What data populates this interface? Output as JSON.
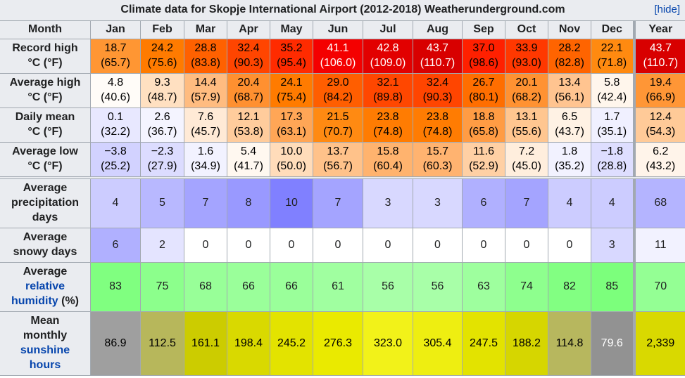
{
  "title": "Climate data for Skopje International Airport (2012-2018) Weatherunderground.com",
  "hide_link": "[hide]",
  "header": {
    "month_label": "Month",
    "months": [
      "Jan",
      "Feb",
      "Mar",
      "Apr",
      "May",
      "Jun",
      "Jul",
      "Aug",
      "Sep",
      "Oct",
      "Nov",
      "Dec"
    ],
    "year_label": "Year"
  },
  "rows": {
    "record_high": {
      "label_line1": "Record high",
      "label_line2": "°C (°F)",
      "values": [
        {
          "c": "18.7",
          "f": "(65.7)",
          "bg": "#ff9633",
          "fg": "#000000"
        },
        {
          "c": "24.2",
          "f": "(75.6)",
          "bg": "#ff7b00",
          "fg": "#000000"
        },
        {
          "c": "28.8",
          "f": "(83.8)",
          "bg": "#ff6100",
          "fg": "#000000"
        },
        {
          "c": "32.4",
          "f": "(90.3)",
          "bg": "#ff4500",
          "fg": "#000000"
        },
        {
          "c": "35.2",
          "f": "(95.4)",
          "bg": "#ff2b00",
          "fg": "#000000"
        },
        {
          "c": "41.1",
          "f": "(106.0)",
          "bg": "#f40000",
          "fg": "#ffffff"
        },
        {
          "c": "42.8",
          "f": "(109.0)",
          "bg": "#e20000",
          "fg": "#ffffff"
        },
        {
          "c": "43.7",
          "f": "(110.7)",
          "bg": "#d80000",
          "fg": "#ffffff"
        },
        {
          "c": "37.0",
          "f": "(98.6)",
          "bg": "#ff2000",
          "fg": "#000000"
        },
        {
          "c": "33.9",
          "f": "(93.0)",
          "bg": "#ff3800",
          "fg": "#000000"
        },
        {
          "c": "28.2",
          "f": "(82.8)",
          "bg": "#ff6400",
          "fg": "#000000"
        },
        {
          "c": "22.1",
          "f": "(71.8)",
          "bg": "#ff8a10",
          "fg": "#000000"
        }
      ],
      "year": {
        "c": "43.7",
        "f": "(110.7)",
        "bg": "#d80000",
        "fg": "#ffffff"
      }
    },
    "average_high": {
      "label_line1": "Average high",
      "label_line2": "°C (°F)",
      "values": [
        {
          "c": "4.8",
          "f": "(40.6)",
          "bg": "#fffcf8",
          "fg": "#000000"
        },
        {
          "c": "9.3",
          "f": "(48.7)",
          "bg": "#ffe0c1",
          "fg": "#000000"
        },
        {
          "c": "14.4",
          "f": "(57.9)",
          "bg": "#ffbc80",
          "fg": "#000000"
        },
        {
          "c": "20.4",
          "f": "(68.7)",
          "bg": "#ff9030",
          "fg": "#000000"
        },
        {
          "c": "24.1",
          "f": "(75.4)",
          "bg": "#ff7b00",
          "fg": "#000000"
        },
        {
          "c": "29.0",
          "f": "(84.2)",
          "bg": "#ff5e00",
          "fg": "#000000"
        },
        {
          "c": "32.1",
          "f": "(89.8)",
          "bg": "#ff4700",
          "fg": "#000000"
        },
        {
          "c": "32.4",
          "f": "(90.3)",
          "bg": "#ff4500",
          "fg": "#000000"
        },
        {
          "c": "26.7",
          "f": "(80.1)",
          "bg": "#ff6e00",
          "fg": "#000000"
        },
        {
          "c": "20.1",
          "f": "(68.2)",
          "bg": "#ff9232",
          "fg": "#000000"
        },
        {
          "c": "13.4",
          "f": "(56.1)",
          "bg": "#ffc490",
          "fg": "#000000"
        },
        {
          "c": "5.8",
          "f": "(42.4)",
          "bg": "#fff6ec",
          "fg": "#000000"
        }
      ],
      "year": {
        "c": "19.4",
        "f": "(66.9)",
        "bg": "#ff9636",
        "fg": "#000000"
      }
    },
    "daily_mean": {
      "label_line1": "Daily mean",
      "label_line2": "°C (°F)",
      "values": [
        {
          "c": "0.1",
          "f": "(32.2)",
          "bg": "#e8e8ff",
          "fg": "#000000"
        },
        {
          "c": "2.6",
          "f": "(36.7)",
          "bg": "#f4f4ff",
          "fg": "#000000"
        },
        {
          "c": "7.6",
          "f": "(45.7)",
          "bg": "#ffead6",
          "fg": "#000000"
        },
        {
          "c": "12.1",
          "f": "(53.8)",
          "bg": "#ffcc9c",
          "fg": "#000000"
        },
        {
          "c": "17.3",
          "f": "(63.1)",
          "bg": "#ffa656",
          "fg": "#000000"
        },
        {
          "c": "21.5",
          "f": "(70.7)",
          "bg": "#ff8a12",
          "fg": "#000000"
        },
        {
          "c": "23.8",
          "f": "(74.8)",
          "bg": "#ff7c02",
          "fg": "#000000"
        },
        {
          "c": "23.8",
          "f": "(74.8)",
          "bg": "#ff7c02",
          "fg": "#000000"
        },
        {
          "c": "18.8",
          "f": "(65.8)",
          "bg": "#ff9c44",
          "fg": "#000000"
        },
        {
          "c": "13.1",
          "f": "(55.6)",
          "bg": "#ffc690",
          "fg": "#000000"
        },
        {
          "c": "6.5",
          "f": "(43.7)",
          "bg": "#fff2e4",
          "fg": "#000000"
        },
        {
          "c": "1.7",
          "f": "(35.1)",
          "bg": "#f0f0ff",
          "fg": "#000000"
        }
      ],
      "year": {
        "c": "12.4",
        "f": "(54.3)",
        "bg": "#ffca98",
        "fg": "#000000"
      }
    },
    "average_low": {
      "label_line1": "Average low",
      "label_line2": "°C (°F)",
      "values": [
        {
          "c": "−3.8",
          "f": "(25.2)",
          "bg": "#d2d2ff",
          "fg": "#000000"
        },
        {
          "c": "−2.3",
          "f": "(27.9)",
          "bg": "#dcdcff",
          "fg": "#000000"
        },
        {
          "c": "1.6",
          "f": "(34.9)",
          "bg": "#f2f2ff",
          "fg": "#000000"
        },
        {
          "c": "5.4",
          "f": "(41.7)",
          "bg": "#fff8f0",
          "fg": "#000000"
        },
        {
          "c": "10.0",
          "f": "(50.0)",
          "bg": "#ffdcba",
          "fg": "#000000"
        },
        {
          "c": "13.7",
          "f": "(56.7)",
          "bg": "#ffc28a",
          "fg": "#000000"
        },
        {
          "c": "15.8",
          "f": "(60.4)",
          "bg": "#ffb36e",
          "fg": "#000000"
        },
        {
          "c": "15.7",
          "f": "(60.3)",
          "bg": "#ffb370",
          "fg": "#000000"
        },
        {
          "c": "11.6",
          "f": "(52.9)",
          "bg": "#ffd0a4",
          "fg": "#000000"
        },
        {
          "c": "7.2",
          "f": "(45.0)",
          "bg": "#ffeedd",
          "fg": "#000000"
        },
        {
          "c": "1.8",
          "f": "(35.2)",
          "bg": "#f2f2ff",
          "fg": "#000000"
        },
        {
          "c": "−1.8",
          "f": "(28.8)",
          "bg": "#dedeff",
          "fg": "#000000"
        }
      ],
      "year": {
        "c": "6.2",
        "f": "(43.2)",
        "bg": "#fff4ea",
        "fg": "#000000"
      }
    },
    "precipitation_days": {
      "label_lines": [
        "Average",
        "precipitation",
        "days"
      ],
      "values": [
        {
          "v": "4",
          "bg": "#ccccff"
        },
        {
          "v": "5",
          "bg": "#b8b8ff"
        },
        {
          "v": "7",
          "bg": "#a4a4ff"
        },
        {
          "v": "8",
          "bg": "#9999ff"
        },
        {
          "v": "10",
          "bg": "#8080ff"
        },
        {
          "v": "7",
          "bg": "#a4a4ff"
        },
        {
          "v": "3",
          "bg": "#d8d8ff"
        },
        {
          "v": "3",
          "bg": "#d8d8ff"
        },
        {
          "v": "6",
          "bg": "#b0b0ff"
        },
        {
          "v": "7",
          "bg": "#a4a4ff"
        },
        {
          "v": "4",
          "bg": "#ccccff"
        },
        {
          "v": "4",
          "bg": "#ccccff"
        }
      ],
      "year": {
        "v": "68",
        "bg": "#b4b4ff"
      }
    },
    "snowy_days": {
      "label_lines": [
        "Average",
        "snowy days"
      ],
      "values": [
        {
          "v": "6",
          "bg": "#b0b0ff"
        },
        {
          "v": "2",
          "bg": "#e4e4ff"
        },
        {
          "v": "0",
          "bg": "#ffffff"
        },
        {
          "v": "0",
          "bg": "#ffffff"
        },
        {
          "v": "0",
          "bg": "#ffffff"
        },
        {
          "v": "0",
          "bg": "#ffffff"
        },
        {
          "v": "0",
          "bg": "#ffffff"
        },
        {
          "v": "0",
          "bg": "#ffffff"
        },
        {
          "v": "0",
          "bg": "#ffffff"
        },
        {
          "v": "0",
          "bg": "#ffffff"
        },
        {
          "v": "0",
          "bg": "#ffffff"
        },
        {
          "v": "3",
          "bg": "#d8d8ff"
        }
      ],
      "year": {
        "v": "11",
        "bg": "#f2f2ff"
      }
    },
    "relative_humidity": {
      "label_line1": "Average",
      "label_link1": "relative",
      "label_link2": "humidity",
      "label_suffix": " (%)",
      "values": [
        {
          "v": "83",
          "bg": "#80ff80"
        },
        {
          "v": "75",
          "bg": "#8cff8c"
        },
        {
          "v": "68",
          "bg": "#98ff98"
        },
        {
          "v": "66",
          "bg": "#9aff9a"
        },
        {
          "v": "66",
          "bg": "#9aff9a"
        },
        {
          "v": "61",
          "bg": "#a0ffa0"
        },
        {
          "v": "56",
          "bg": "#a8ffa8"
        },
        {
          "v": "56",
          "bg": "#a8ffa8"
        },
        {
          "v": "63",
          "bg": "#9eff9e"
        },
        {
          "v": "74",
          "bg": "#8eff8e"
        },
        {
          "v": "82",
          "bg": "#82ff82"
        },
        {
          "v": "85",
          "bg": "#7cff7c"
        }
      ],
      "year": {
        "v": "70",
        "bg": "#94ff94"
      }
    },
    "sunshine_hours": {
      "label_line1": "Mean",
      "label_line2": "monthly",
      "label_link1": "sunshine",
      "label_link2": "hours",
      "values": [
        {
          "v": "86.9",
          "bg": "#9f9f9f",
          "fg": "#000000"
        },
        {
          "v": "112.5",
          "bg": "#b7b75b",
          "fg": "#000000"
        },
        {
          "v": "161.1",
          "bg": "#cccc00",
          "fg": "#000000"
        },
        {
          "v": "198.4",
          "bg": "#d9d900",
          "fg": "#000000"
        },
        {
          "v": "245.2",
          "bg": "#e3e300",
          "fg": "#000000"
        },
        {
          "v": "276.3",
          "bg": "#eaea00",
          "fg": "#000000"
        },
        {
          "v": "323.0",
          "bg": "#f2f219",
          "fg": "#000000"
        },
        {
          "v": "305.4",
          "bg": "#eeee11",
          "fg": "#000000"
        },
        {
          "v": "247.5",
          "bg": "#e3e300",
          "fg": "#000000"
        },
        {
          "v": "188.2",
          "bg": "#d6d600",
          "fg": "#000000"
        },
        {
          "v": "114.8",
          "bg": "#b7b75e",
          "fg": "#000000"
        },
        {
          "v": "79.6",
          "bg": "#929292",
          "fg": "#ffffff"
        }
      ],
      "year": {
        "v": "2,339",
        "bg": "#d9d900",
        "fg": "#000000"
      }
    }
  }
}
